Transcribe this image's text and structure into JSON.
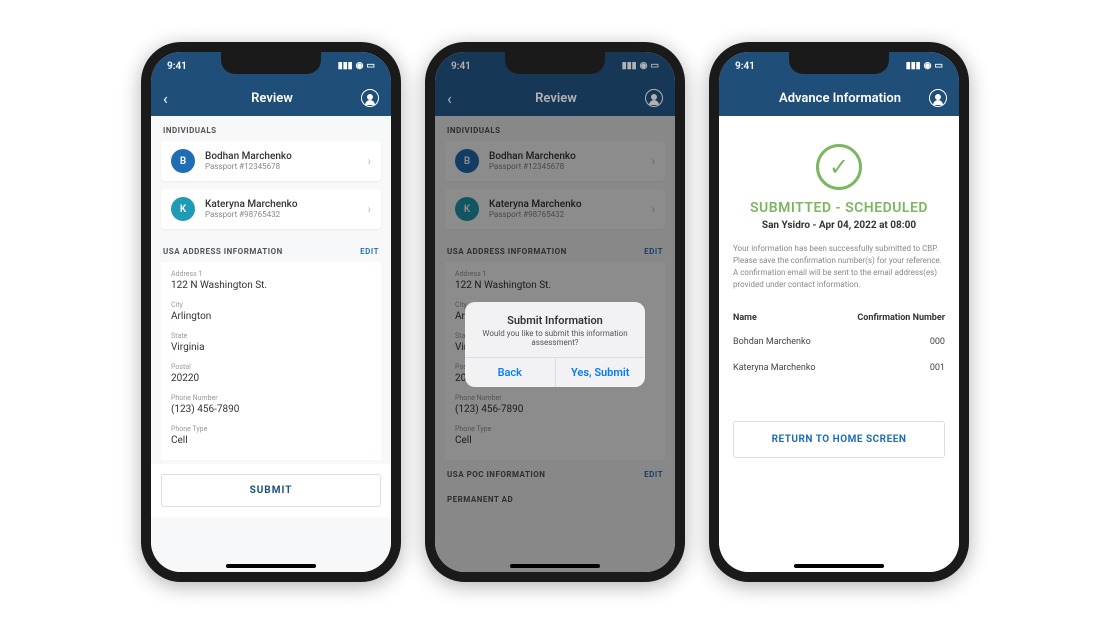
{
  "status": {
    "time": "9:41"
  },
  "phone1": {
    "title": "Review",
    "individuals_header": "INDIVIDUALS",
    "people": [
      {
        "initial": "B",
        "name": "Bodhan Marchenko",
        "sub": "Passport #12345678",
        "avatar": "blue"
      },
      {
        "initial": "K",
        "name": "Kateryna Marchenko",
        "sub": "Passport #98765432",
        "avatar": "teal"
      }
    ],
    "address_header": "USA ADDRESS INFORMATION",
    "edit": "EDIT",
    "fields": [
      {
        "label": "Address 1",
        "value": "122 N Washington St."
      },
      {
        "label": "City",
        "value": "Arlington"
      },
      {
        "label": "State",
        "value": "Virginia"
      },
      {
        "label": "Postal",
        "value": "20220"
      },
      {
        "label": "Phone Number",
        "value": "(123) 456-7890"
      },
      {
        "label": "Phone Type",
        "value": "Cell"
      }
    ],
    "submit": "SUBMIT"
  },
  "phone2": {
    "title": "Review",
    "poc_header": "USA POC INFORMATION",
    "perm_header": "PERMANENT AD",
    "modal": {
      "title": "Submit Information",
      "msg": "Would you like to submit this information assessment?",
      "back": "Back",
      "yes": "Yes, Submit"
    }
  },
  "phone3": {
    "title": "Advance Information",
    "status": "SUBMITTED - SCHEDULED",
    "sub": "San Ysidro - Apr 04, 2022 at 08:00",
    "body": "Your information has been successfully submitted to CBP. Please save the confirmation number(s) for your reference. A confirmation email will be sent to the email address(es) provided under contact information.",
    "col1": "Name",
    "col2": "Confirmation Number",
    "rows": [
      {
        "name": "Bohdan Marchenko",
        "num": "000"
      },
      {
        "name": "Kateryna Marchenko",
        "num": "001"
      }
    ],
    "return": "RETURN TO HOME SCREEN"
  }
}
